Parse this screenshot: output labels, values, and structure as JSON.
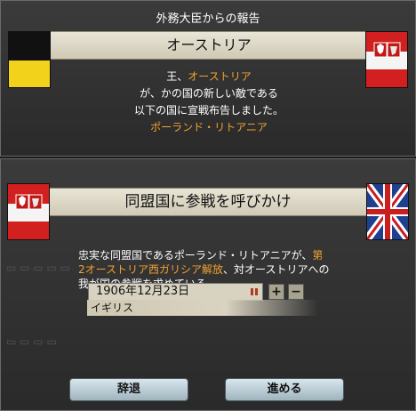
{
  "report": {
    "heading": "外務大臣からの報告",
    "title": "オーストリア",
    "line1_prefix": "王、",
    "line1_country": "オーストリア",
    "line2": "が、かの国の新しい敵である",
    "line3": "以下の国に宣戦布告しました。",
    "line4_country": "ポーランド・リトアニア"
  },
  "alliance": {
    "title": "同盟国に参戦を呼びかけ",
    "body_part1": "忠実な同盟国であるポーランド・リトアニアが、",
    "body_hl1": "第",
    "body_hl2": "2オーストリア西ガリシア解放",
    "body_part2": "、対オーストリアへの",
    "body_part3": "我が国の参戦を求めている",
    "date": "1906年12月23日",
    "country": "イギリス",
    "zoom_in": "+",
    "zoom_out": "−"
  },
  "buttons": {
    "decline": "辞退",
    "proceed": "進める"
  },
  "colors": {
    "highlight": "#f2a030",
    "banner": "#e0dccb",
    "button": "#c3d3da"
  },
  "icons": [
    "habsburg-flag-icon",
    "polish-lithuanian-flag-icon",
    "british-flag-icon",
    "pause-icon"
  ]
}
